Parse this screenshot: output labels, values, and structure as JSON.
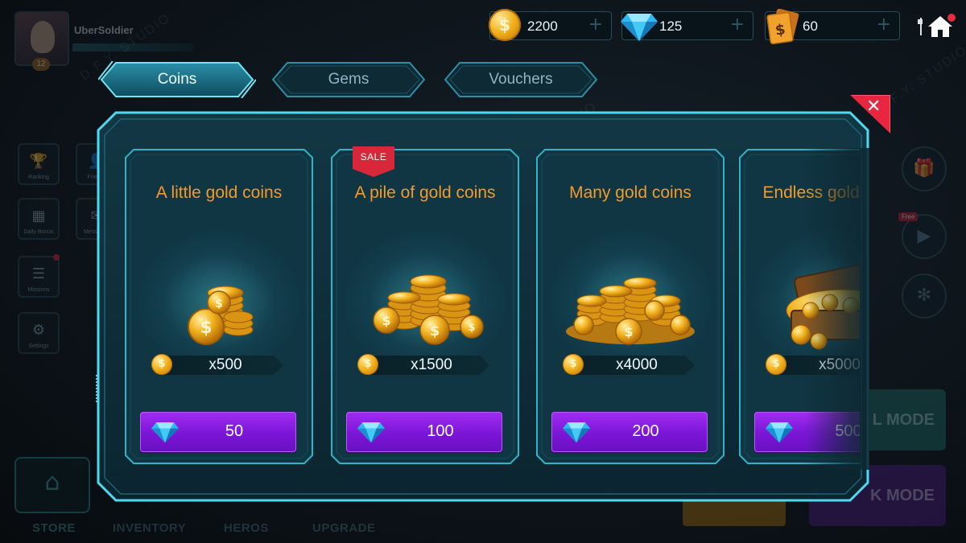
{
  "player": {
    "name": "UberSoldier",
    "level": "12"
  },
  "currencies": [
    {
      "name": "coins",
      "amount": "2200",
      "icon": "coin-icon",
      "add_label": "+"
    },
    {
      "name": "gems",
      "amount": "125",
      "icon": "gem-icon",
      "add_label": "+"
    },
    {
      "name": "vouchers",
      "amount": "60",
      "icon": "voucher-icon",
      "add_label": "+"
    }
  ],
  "tabs": [
    {
      "label": "Coins",
      "active": true
    },
    {
      "label": "Gems",
      "active": false
    },
    {
      "label": "Vouchers",
      "active": false
    }
  ],
  "close_label": "✕",
  "products": [
    {
      "title": "A little gold coins",
      "quantity": "x500",
      "price": "50",
      "sale": false
    },
    {
      "title": "A pile of gold coins",
      "quantity": "x1500",
      "price": "100",
      "sale": true,
      "sale_label": "SALE"
    },
    {
      "title": "Many gold coins",
      "quantity": "x4000",
      "price": "200",
      "sale": false
    },
    {
      "title": "Endless gold coins",
      "quantity": "x5000",
      "price": "500",
      "sale": false
    }
  ],
  "background": {
    "side_buttons": [
      "Ranking",
      "Friends",
      "Daily Bonus",
      "Messages",
      "Missions",
      "Settings"
    ],
    "bottom_nav": [
      "STORE",
      "INVENTORY",
      "HEROS",
      "UPGRADE"
    ],
    "free_tag": "Free",
    "mode_buttons": [
      "L MODE",
      "K MODE"
    ]
  },
  "watermark": "D.F.Y. STUDIO",
  "colors": {
    "accent_cyan": "#4fd9ee",
    "title_orange": "#f29a2b",
    "buy_purple": "#8a1ee6",
    "close_red": "#e8263f",
    "panel_bg": "#0f2e3a"
  }
}
